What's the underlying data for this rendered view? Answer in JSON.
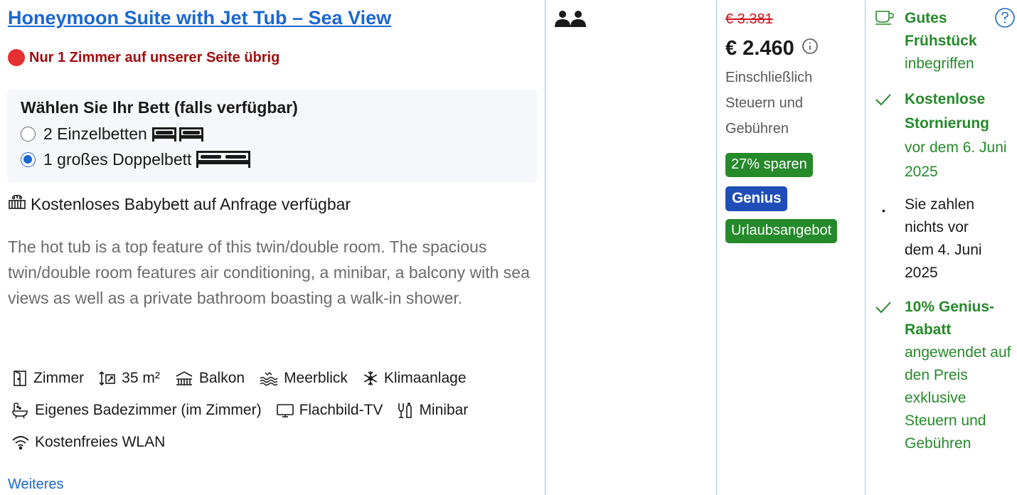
{
  "room": {
    "title": "Honeymoon Suite with Jet Tub – Sea View",
    "urgency": "Nur 1 Zimmer auf unserer Seite übrig",
    "bed_heading": "Wählen Sie Ihr Bett (falls verfügbar)",
    "bed_options": [
      {
        "label": "2 Einzelbetten",
        "selected": false
      },
      {
        "label": "1 großes Doppelbett",
        "selected": true
      }
    ],
    "crib": "Kostenloses Babybett auf Anfrage verfügbar",
    "description": "The hot tub is a top feature of this twin/double room. The spacious twin/double room features air conditioning, a minibar, a balcony with sea views as well as a private bathroom boasting a walk-in shower.",
    "facilities": [
      {
        "label": "Zimmer",
        "icon": "door-icon"
      },
      {
        "label": "35 m²",
        "icon": "room-size-icon"
      },
      {
        "label": "Balkon",
        "icon": "balcony-icon"
      },
      {
        "label": "Meerblick",
        "icon": "sea-view-icon"
      },
      {
        "label": "Klimaanlage",
        "icon": "snowflake-icon"
      },
      {
        "label": "Eigenes Badezimmer (im Zimmer)",
        "icon": "bathtub-icon"
      },
      {
        "label": "Flachbild-TV",
        "icon": "tv-icon"
      },
      {
        "label": "Minibar",
        "icon": "minibar-icon"
      },
      {
        "label": "Kostenfreies WLAN",
        "icon": "wifi-icon"
      }
    ],
    "more_link": "Weiteres"
  },
  "guests": {
    "icon": "two-persons-icon"
  },
  "pricing": {
    "original": "€ 3.381",
    "current": "€ 2.460",
    "tax_note": "Einschließlich Steuern und Gebühren",
    "badges": {
      "save": "27% sparen",
      "genius": "Genius",
      "vacation": "Urlaubsangebot"
    }
  },
  "choices": {
    "breakfast_bold": "Gutes Frühstück",
    "breakfast_rest": "inbegriffen",
    "cancel_bold": "Kostenlose Stornierung",
    "cancel_rest": "vor dem 6. Juni 2025",
    "pay_later": "Sie zahlen nichts vor dem 4. Juni 2025",
    "genius_bold": "10% Genius-Rabatt",
    "genius_rest": "angewendet auf den Preis exklusive Steuern und Gebühren"
  },
  "colors": {
    "link_blue": "#1a67d2",
    "urgency_red": "#a30c0c",
    "strike_red": "#d4111e",
    "success_green": "#258a2a",
    "genius_blue": "#1f4eb8",
    "divider": "#9fc4e8"
  }
}
